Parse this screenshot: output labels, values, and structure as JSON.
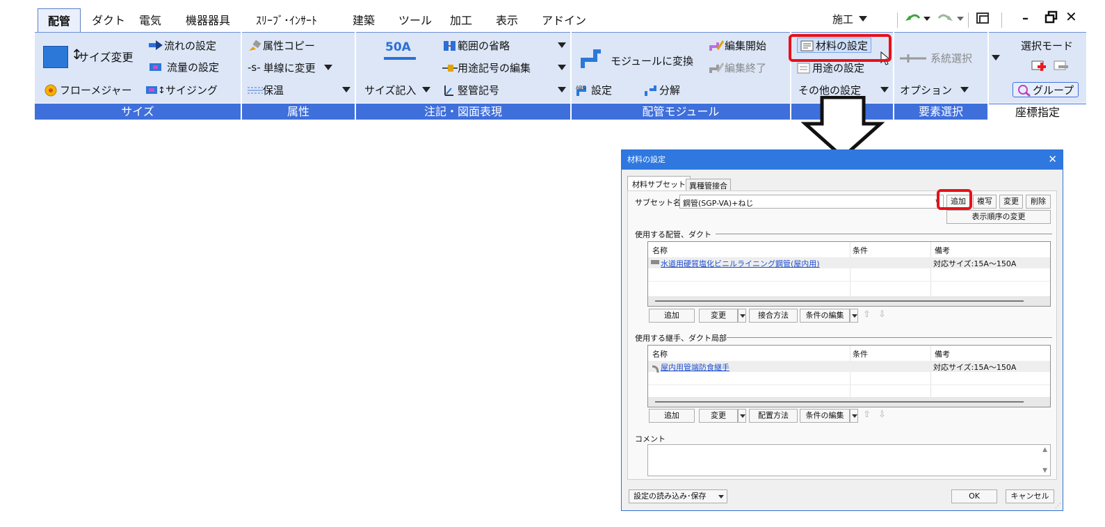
{
  "ribbon": {
    "tabs": [
      "配管",
      "ダクト",
      "電気",
      "機器器具",
      "ｽﾘｰﾌﾞ･ｲﾝｻｰﾄ",
      "建築",
      "ツール",
      "加工",
      "表示",
      "アドイン"
    ],
    "right_dropdown": "施工",
    "groups": {
      "size": {
        "label": "サイズ",
        "size_change": "サイズ変更",
        "flow_setting": "流れの設定",
        "flow_rate_setting": "流量の設定",
        "flow_measure": "フローメジャー",
        "sizing": "サイジング"
      },
      "attr": {
        "label": "属性",
        "attr_copy": "属性コピー",
        "single_line": "単線に変更",
        "single_line_icon_text": "-s-",
        "insulation": "保温"
      },
      "annotation": {
        "label": "注記・図面表現",
        "size_icon_text": "50A",
        "size_write": "サイズ記入",
        "range_omit": "範囲の省略",
        "usage_symbol_edit": "用途記号の編集",
        "vertical_symbol": "竪管記号"
      },
      "module": {
        "label": "配管モジュール",
        "convert": "モジュールに変換",
        "edit_start": "編集開始",
        "edit_end": "編集終了",
        "setting": "設定",
        "decompose": "分解"
      },
      "material": {
        "material_setting": "材料の設定",
        "usage_setting": "用途の設定",
        "other_setting": "その他の設定"
      },
      "select": {
        "label": "要素選択",
        "system_select": "系統選択",
        "option": "オプション"
      },
      "coord": {
        "label": "座標指定",
        "select_mode": "選択モード",
        "group": "グループ"
      }
    }
  },
  "dialog": {
    "title": "材料の設定",
    "tabs": [
      "材料サブセット",
      "異種管接合"
    ],
    "subset_label": "サブセット名",
    "subset_value": "鋼管(SGP-VA)+ねじ",
    "buttons": {
      "add": "追加",
      "copy": "複写",
      "change": "変更",
      "delete": "削除",
      "display_order": "表示順序の変更"
    },
    "pipe_section": {
      "heading": "使用する配管、ダクト",
      "columns": [
        "名称",
        "条件",
        "備考"
      ],
      "rows": [
        {
          "name": "水道用硬質塩化ビニルライニング鋼管(屋内用)",
          "condition": "",
          "note": "対応サイズ:15A～150A"
        }
      ],
      "actions": [
        "追加",
        "変更",
        "接合方法",
        "条件の編集"
      ]
    },
    "fitting_section": {
      "heading": "使用する継手、ダクト局部",
      "columns": [
        "名称",
        "条件",
        "備考"
      ],
      "rows": [
        {
          "name": "屋内用管端防食継手",
          "condition": "",
          "note": "対応サイズ:15A～150A"
        }
      ],
      "actions": [
        "追加",
        "変更",
        "配置方法",
        "条件の編集"
      ]
    },
    "comment_label": "コメント",
    "footer": {
      "load_save": "設定の読み込み･保存",
      "ok": "OK",
      "cancel": "キャンセル"
    }
  },
  "colors": {
    "ribbon_body": "#dce6f7",
    "group_label_bg": "#3f6fdb",
    "highlight": "#e8101a",
    "dialog_title": "#2f78e0"
  }
}
